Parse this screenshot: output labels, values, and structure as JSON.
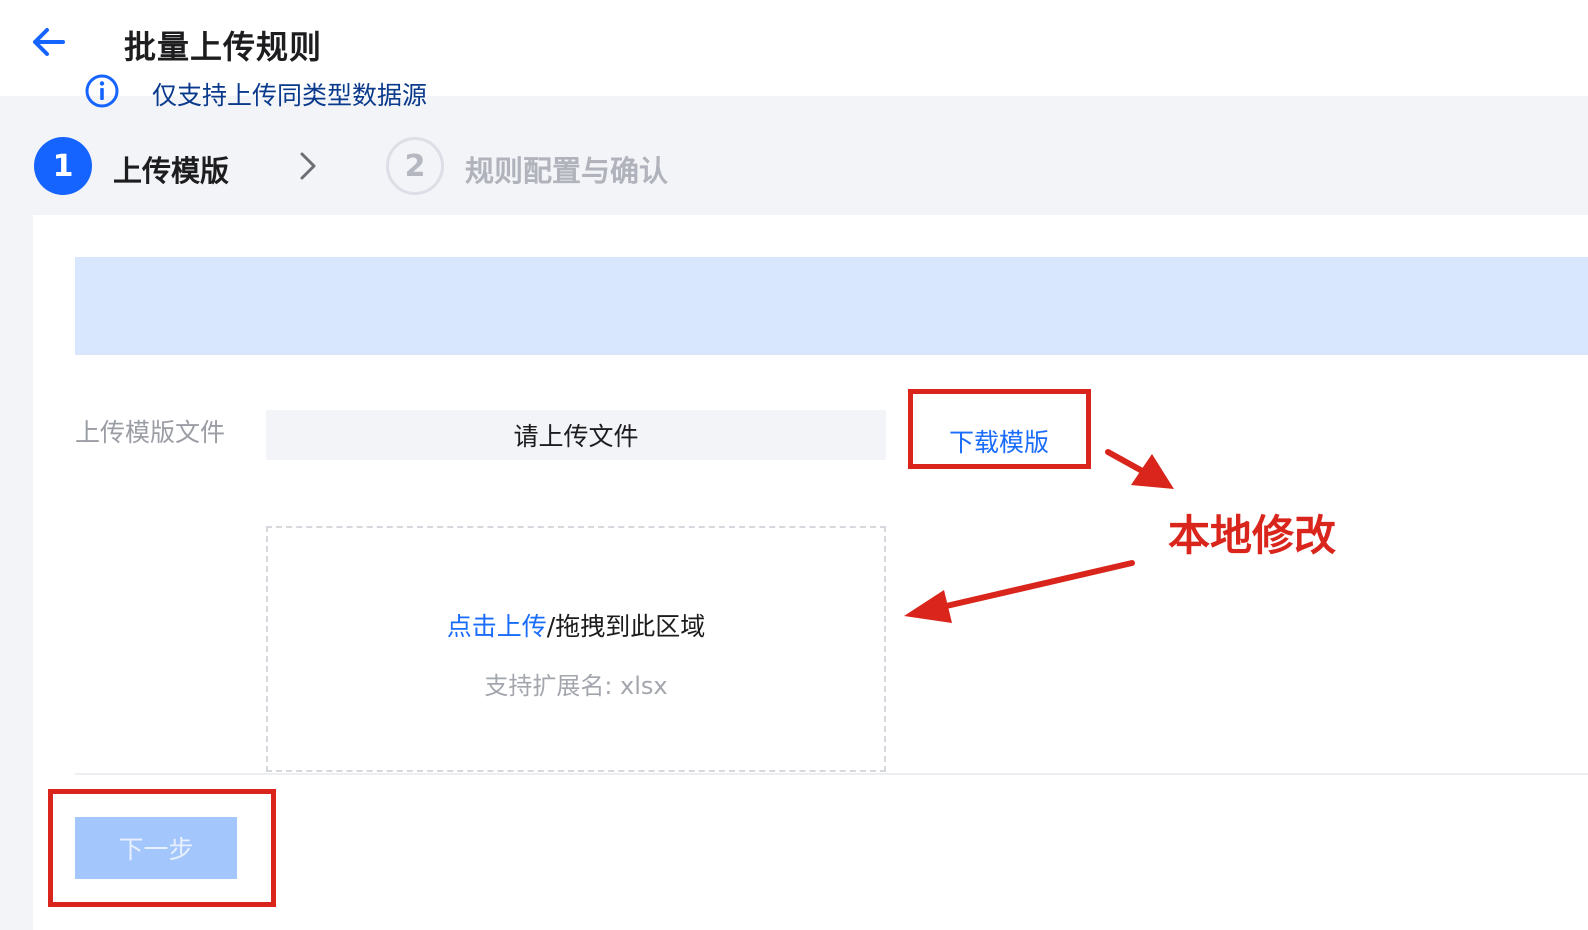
{
  "header": {
    "title": "批量上传规则",
    "back_icon": "arrow-left-icon"
  },
  "steps": [
    {
      "number": "1",
      "label": "上传模版",
      "state": "active"
    },
    {
      "number": "2",
      "label": "规则配置与确认",
      "state": "pending"
    }
  ],
  "alert": {
    "icon": "info-icon",
    "text": "仅支持上传同类型数据源"
  },
  "form": {
    "upload_label": "上传模版文件",
    "file_input_placeholder": "请上传文件",
    "download_template": "下载模版"
  },
  "dropzone": {
    "click_upload": "点击上传",
    "drag_text": "/拖拽到此区域",
    "extensions": "支持扩展名: xlsx"
  },
  "footer": {
    "next_label": "下一步",
    "next_disabled": true
  },
  "annotation": {
    "note": "本地修改",
    "color": "#d9251b"
  },
  "colors": {
    "primary": "#1664ff",
    "link": "#1a6cfa",
    "alert_bg": "#d8e7fd",
    "disabled_button": "#a3c6fc"
  }
}
